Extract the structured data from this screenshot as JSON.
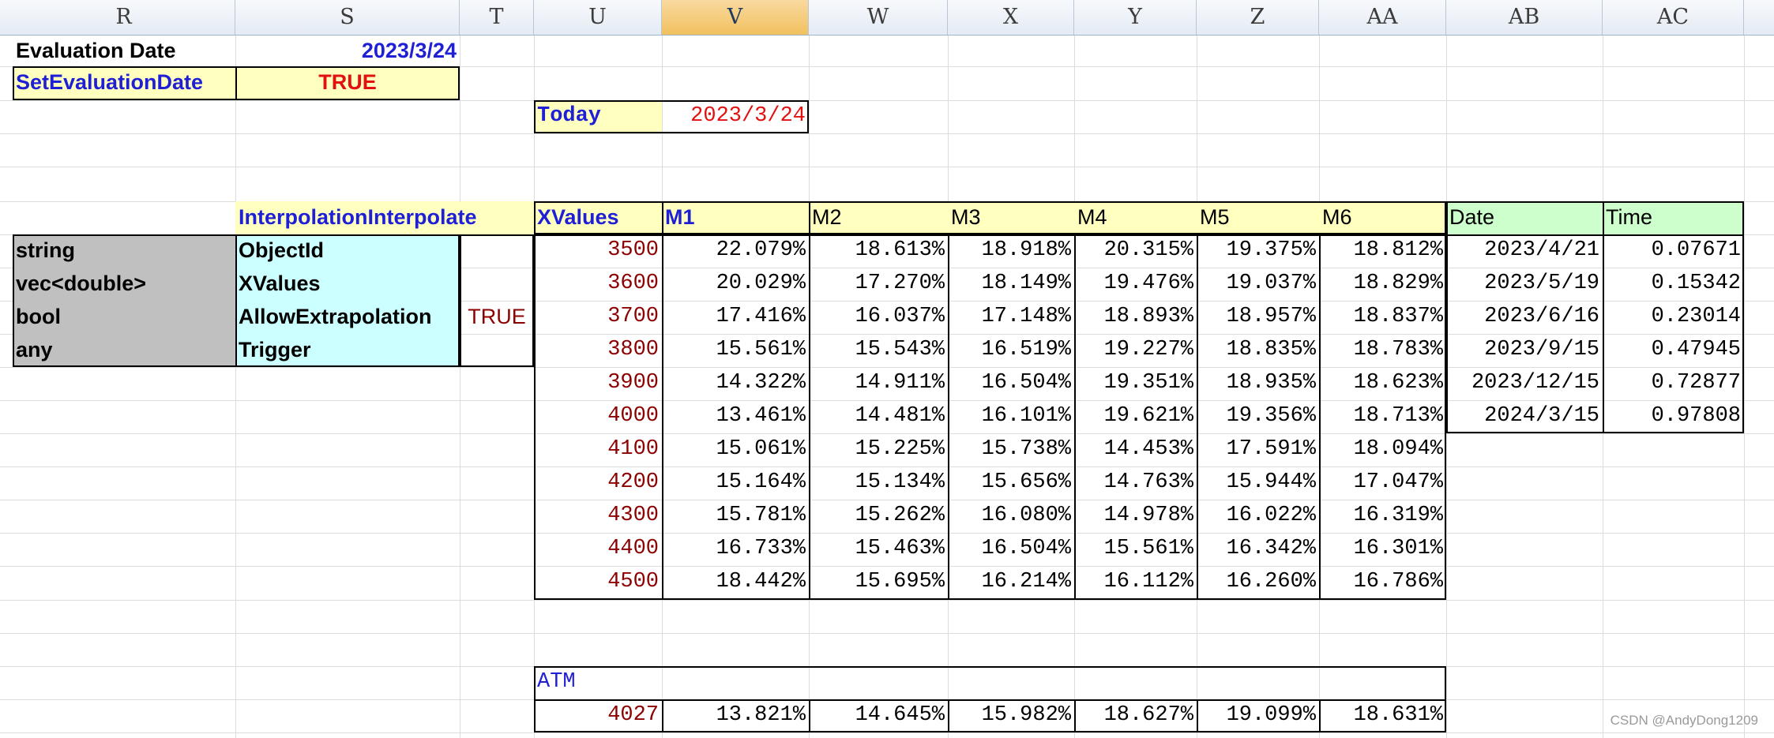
{
  "columns": [
    "R",
    "S",
    "T",
    "U",
    "V",
    "W",
    "X",
    "Y",
    "Z",
    "AA",
    "AB",
    "AC"
  ],
  "selected_column": "V",
  "evaluation": {
    "label": "Evaluation Date",
    "value": "2023/3/24",
    "set_label": "SetEvaluationDate",
    "set_value": "TRUE"
  },
  "today": {
    "label": "Today",
    "value": "2023/3/24"
  },
  "interp": {
    "title": "InterpolationInterpolate",
    "types": [
      "string",
      "vec<double>",
      "bool",
      "any"
    ],
    "params": [
      "ObjectId",
      "XValues",
      "AllowExtrapolation",
      "Trigger"
    ],
    "allow_extrapolation_value": "TRUE"
  },
  "table": {
    "xvalues_header": "XValues",
    "months": [
      "M1",
      "M2",
      "M3",
      "M4",
      "M5",
      "M6"
    ],
    "xvalues": [
      "3500",
      "3600",
      "3700",
      "3800",
      "3900",
      "4000",
      "4100",
      "4200",
      "4300",
      "4400",
      "4500"
    ],
    "rows": [
      [
        "22.079%",
        "18.613%",
        "18.918%",
        "20.315%",
        "19.375%",
        "18.812%"
      ],
      [
        "20.029%",
        "17.270%",
        "18.149%",
        "19.476%",
        "19.037%",
        "18.829%"
      ],
      [
        "17.416%",
        "16.037%",
        "17.148%",
        "18.893%",
        "18.957%",
        "18.837%"
      ],
      [
        "15.561%",
        "15.543%",
        "16.519%",
        "19.227%",
        "18.835%",
        "18.783%"
      ],
      [
        "14.322%",
        "14.911%",
        "16.504%",
        "19.351%",
        "18.935%",
        "18.623%"
      ],
      [
        "13.461%",
        "14.481%",
        "16.101%",
        "19.621%",
        "19.356%",
        "18.713%"
      ],
      [
        "15.061%",
        "15.225%",
        "15.738%",
        "14.453%",
        "17.591%",
        "18.094%"
      ],
      [
        "15.164%",
        "15.134%",
        "15.656%",
        "14.763%",
        "15.944%",
        "17.047%"
      ],
      [
        "15.781%",
        "15.262%",
        "16.080%",
        "14.978%",
        "16.022%",
        "16.319%"
      ],
      [
        "16.733%",
        "15.463%",
        "16.504%",
        "15.561%",
        "16.342%",
        "16.301%"
      ],
      [
        "18.442%",
        "15.695%",
        "16.214%",
        "16.112%",
        "16.260%",
        "16.786%"
      ]
    ]
  },
  "dates": {
    "date_header": "Date",
    "time_header": "Time",
    "rows": [
      [
        "2023/4/21",
        "0.07671"
      ],
      [
        "2023/5/19",
        "0.15342"
      ],
      [
        "2023/6/16",
        "0.23014"
      ],
      [
        "2023/9/15",
        "0.47945"
      ],
      [
        "2023/12/15",
        "0.72877"
      ],
      [
        "2024/3/15",
        "0.97808"
      ]
    ]
  },
  "atm": {
    "label": "ATM",
    "x": "4027",
    "values": [
      "13.821%",
      "14.645%",
      "15.982%",
      "18.627%",
      "19.099%",
      "18.631%"
    ]
  },
  "watermark": "CSDN @AndyDong1209",
  "colors": {
    "header_yellow": "#ffffc0",
    "type_gray": "#c0c0c0",
    "param_cyan": "#ccffff",
    "date_green": "#ccffcc",
    "label_blue": "#1f1fd6",
    "value_red": "#e31010",
    "xvalue_darkred": "#8b0000",
    "selected_col": "#f5c86e"
  }
}
